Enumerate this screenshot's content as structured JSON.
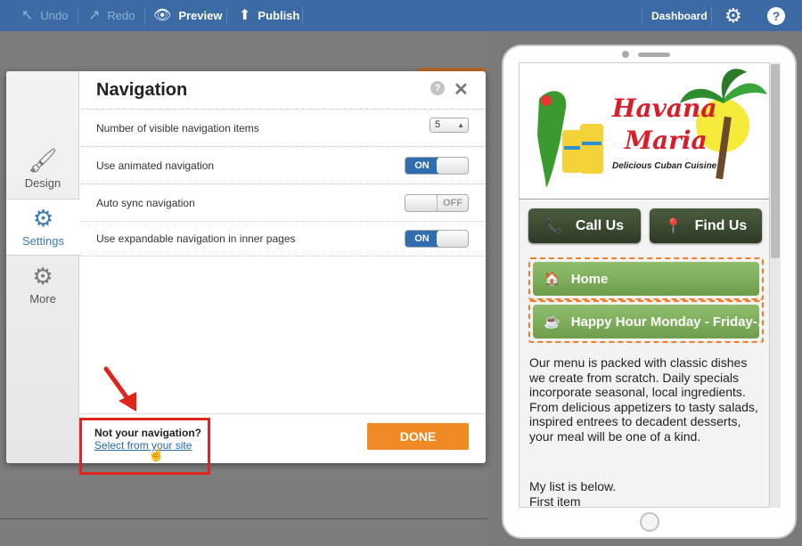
{
  "toolbar": {
    "undo": "Undo",
    "redo": "Redo",
    "preview": "Preview",
    "publish": "Publish",
    "dashboard": "Dashboard"
  },
  "dialog": {
    "title": "Navigation",
    "sidebar": [
      {
        "label": "Design",
        "icon": "brush-icon"
      },
      {
        "label": "Settings",
        "icon": "gear-icon",
        "active": true
      },
      {
        "label": "More",
        "icon": "gears-icon"
      }
    ],
    "settings": {
      "visible_items_label": "Number of visible navigation items",
      "visible_items_value": "5",
      "animated_label": "Use animated navigation",
      "animated_state": "ON",
      "autosync_label": "Auto sync navigation",
      "autosync_state": "OFF",
      "expandable_label": "Use expandable navigation in inner pages",
      "expandable_state": "ON"
    },
    "footer": {
      "question": "Not your navigation?",
      "link": "Select from your site",
      "done": "DONE"
    }
  },
  "preview": {
    "logo_line1": "Havana",
    "logo_line2": "Maria",
    "logo_sub": "Delicious Cuban Cuisine",
    "call_btn": "Call Us",
    "find_btn": "Find Us",
    "nav_items": [
      "Home",
      "Happy Hour Monday - Friday-..."
    ],
    "paragraph": "Our menu is packed with classic dishes we create from scratch. Daily specials incorporate seasonal, local ingredients. From delicious appetizers to tasty salads, inspired entrees to decadent desserts, your meal will be one of a kind.",
    "list_intro": "My list is below.",
    "list_first": "First item"
  },
  "colors": {
    "toolbar": "#3b6aa5",
    "accent": "#f08a24",
    "highlight": "#e0261c",
    "nav_green": "#7fae5c"
  }
}
